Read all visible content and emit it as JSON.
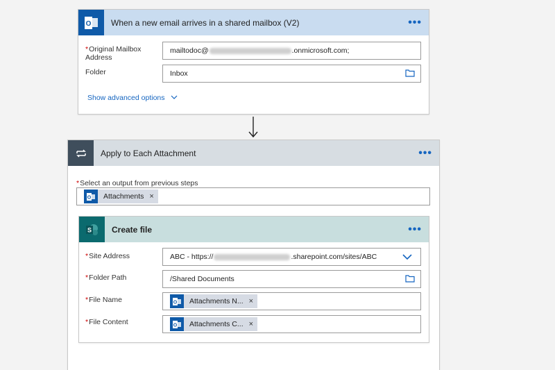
{
  "trigger": {
    "title": "When a new email arrives in a shared mailbox (V2)",
    "more": "•••",
    "original_mailbox_label": "Original Mailbox Address",
    "original_mailbox_value_prefix": "mailtodoc@",
    "original_mailbox_value_suffix": ".onmicrosoft.com;",
    "folder_label": "Folder",
    "folder_value": "Inbox",
    "show_advanced": "Show advanced options"
  },
  "connector_arrow": "↓",
  "apply_each": {
    "title": "Apply to Each Attachment",
    "more": "•••",
    "select_output_label": "Select an output from previous steps",
    "token_label": "Attachments",
    "token_remove": "×"
  },
  "create_file": {
    "title": "Create file",
    "more": "•••",
    "site_address_label": "Site Address",
    "site_address_prefix": "ABC - https://",
    "site_address_suffix": ".sharepoint.com/sites/ABC",
    "folder_path_label": "Folder Path",
    "folder_path_value": "/Shared Documents",
    "file_name_label": "File Name",
    "file_name_token": "Attachments N...",
    "file_content_label": "File Content",
    "file_content_token": "Attachments C...",
    "token_remove": "×"
  },
  "required_mark": "*",
  "colors": {
    "outlook_blue": "#0f5aa8",
    "trigger_header": "#c9dcf0",
    "apply_header": "#d7dde2",
    "apply_icon": "#3f4e5c",
    "sharepoint_teal": "#0b6a6e",
    "create_header": "#c8dede",
    "link_blue": "#1565c0"
  },
  "icons": {
    "outlook": "outlook-icon",
    "loop": "loop-icon",
    "sharepoint": "sharepoint-icon",
    "folder": "folder-icon",
    "chevron": "chevron-down-icon"
  }
}
